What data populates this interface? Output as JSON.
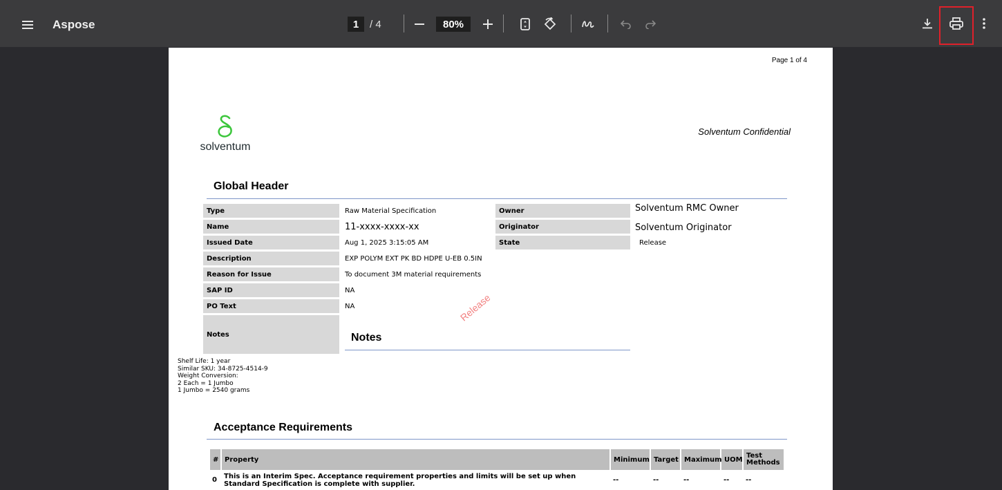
{
  "toolbar": {
    "app_title": "Aspose",
    "current_page": "1",
    "page_total": "/ 4",
    "zoom": "80%",
    "minus": "−",
    "plus": "+"
  },
  "page": {
    "page_label": "Page 1 of 4",
    "logo_text": "solventum",
    "confidential": "Solventum Confidential",
    "watermark": "Release"
  },
  "global_header": {
    "title": "Global Header",
    "rows": [
      {
        "label": "Type",
        "value": "Raw Material Specification"
      },
      {
        "label": "Name",
        "value": "11-xxxx-xxxx-xx"
      },
      {
        "label": "Issued Date",
        "value": "Aug 1, 2025 3:15:05 AM"
      },
      {
        "label": "Description",
        "value": "EXP POLYM EXT PK BD HDPE U-EB 0.5IN"
      },
      {
        "label": "Reason for Issue",
        "value": "To document 3M material requirements"
      },
      {
        "label": "SAP ID",
        "value": "NA"
      },
      {
        "label": "PO Text",
        "value": "NA"
      },
      {
        "label": "Notes",
        "value": ""
      }
    ],
    "right_rows": [
      {
        "label": "Owner",
        "value": "Solventum RMC Owner"
      },
      {
        "label": "Originator",
        "value": "Solventum Originator"
      },
      {
        "label": "State",
        "value": "Release"
      }
    ]
  },
  "notes": {
    "title": "Notes",
    "text": "Shelf Life: 1 year\nSimilar SKU: 34-8725-4514-9\nWeight Conversion:\n2 Each = 1 Jumbo\n1 Jumbo = 2540 grams"
  },
  "acceptance": {
    "title": "Acceptance Requirements",
    "headers": [
      "#",
      "Property",
      "Minimum",
      "Target",
      "Maximum",
      "UOM",
      "Test Methods"
    ],
    "rows": [
      {
        "num": "0",
        "property": "This is an Interim Spec. Acceptance requirement properties and limits will be set up when Standard Specification is complete with supplier.",
        "minimum": "--",
        "target": "--",
        "maximum": "--",
        "uom": "--",
        "test": "--"
      }
    ]
  },
  "colors": {
    "toolbar_bg": "#3b3b3d",
    "viewer_bg": "#2a2a2e",
    "highlight": "#e0202a",
    "logo_green": "#3cc63c",
    "watermark": "#f06a6a"
  }
}
